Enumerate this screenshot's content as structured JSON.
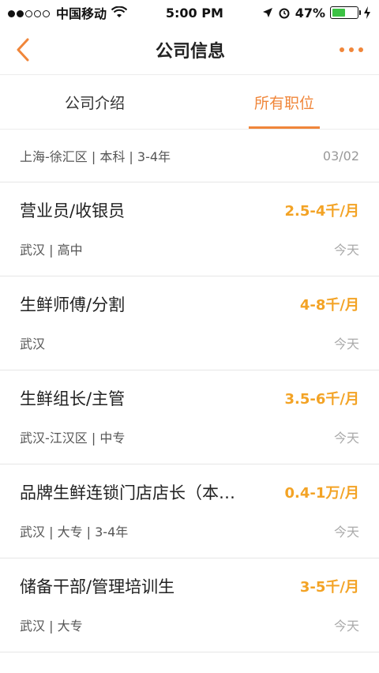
{
  "status": {
    "carrier": "中国移动",
    "time": "5:00 PM",
    "battery": "47%"
  },
  "nav": {
    "title": "公司信息"
  },
  "tabs": [
    {
      "label": "公司介绍"
    },
    {
      "label": "所有职位"
    }
  ],
  "partial_item": {
    "meta": "上海-徐汇区 | 本科 | 3-4年",
    "date": "03/02"
  },
  "jobs": [
    {
      "title": "营业员/收银员",
      "salary": "2.5-4千/月",
      "meta": "武汉 | 高中",
      "date": "今天"
    },
    {
      "title": "生鲜师傅/分割",
      "salary": "4-8千/月",
      "meta": "武汉",
      "date": "今天"
    },
    {
      "title": "生鲜组长/主管",
      "salary": "3.5-6千/月",
      "meta": "武汉-江汉区 | 中专",
      "date": "今天"
    },
    {
      "title": "品牌生鲜连锁门店店长（本…",
      "salary": "0.4-1万/月",
      "meta": "武汉 | 大专 | 3-4年",
      "date": "今天"
    },
    {
      "title": "储备干部/管理培训生",
      "salary": "3-5千/月",
      "meta": "武汉 | 大专",
      "date": "今天"
    }
  ]
}
